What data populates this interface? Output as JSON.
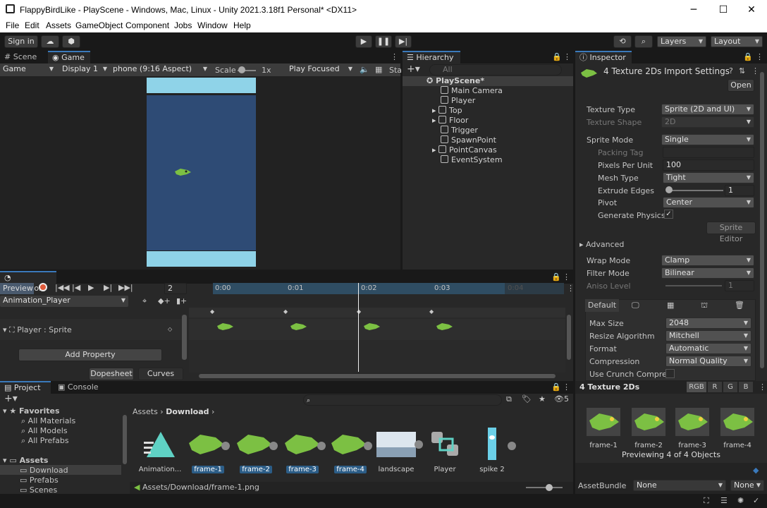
{
  "window": {
    "title": "FlappyBirdLike - PlayScene - Windows, Mac, Linux - Unity 2021.3.18f1 Personal* <DX11>"
  },
  "menu": [
    "File",
    "Edit",
    "Assets",
    "GameObject",
    "Component",
    "Jobs",
    "Window",
    "Help"
  ],
  "toolbar": {
    "sign_in": "Sign in",
    "layers": "Layers",
    "layout": "Layout"
  },
  "game": {
    "tabs": [
      "Scene",
      "Game"
    ],
    "mode": "Game",
    "display": "Display 1",
    "aspect": "phone (9:16 Aspect)",
    "scale_label": "Scale",
    "scale_value": "1x",
    "play_focused": "Play Focused",
    "stats": "Sta"
  },
  "hierarchy": {
    "tab": "Hierarchy",
    "search_placeholder": "All",
    "scene": "PlayScene*",
    "items": [
      "Main Camera",
      "Player",
      "Top",
      "Floor",
      "Trigger",
      "SpawnPoint",
      "PointCanvas",
      "EventSystem"
    ]
  },
  "inspector": {
    "tab": "Inspector",
    "title": "4 Texture 2Ds Import Settings",
    "open": "Open",
    "texture_type_label": "Texture Type",
    "texture_type": "Sprite (2D and UI)",
    "texture_shape_label": "Texture Shape",
    "texture_shape": "2D",
    "sprite_mode_label": "Sprite Mode",
    "sprite_mode": "Single",
    "packing_tag_label": "Packing Tag",
    "ppu_label": "Pixels Per Unit",
    "ppu": "100",
    "mesh_type_label": "Mesh Type",
    "mesh_type": "Tight",
    "extrude_label": "Extrude Edges",
    "extrude": "1",
    "pivot_label": "Pivot",
    "pivot": "Center",
    "gen_physics_label": "Generate Physics S",
    "sprite_editor": "Sprite Editor",
    "advanced": "Advanced",
    "wrap_label": "Wrap Mode",
    "wrap": "Clamp",
    "filter_label": "Filter Mode",
    "filter": "Bilinear",
    "aniso_label": "Aniso Level",
    "aniso": "1",
    "platform_default": "Default",
    "max_size_label": "Max Size",
    "max_size": "2048",
    "resize_label": "Resize Algorithm",
    "resize": "Mitchell",
    "format_label": "Format",
    "format": "Automatic",
    "compression_label": "Compression",
    "compression": "Normal Quality",
    "crunch_label": "Use Crunch Compres"
  },
  "preview": {
    "title": "4 Texture 2Ds",
    "channels": [
      "RGB",
      "R",
      "G",
      "B"
    ],
    "frames": [
      "frame-1",
      "frame-2",
      "frame-3",
      "frame-4"
    ],
    "status": "Previewing 4 of 4 Objects",
    "assetbundle_label": "AssetBundle",
    "assetbundle": "None",
    "variant": "None"
  },
  "animation": {
    "tab": "Animation",
    "preview": "Preview",
    "frame": "2",
    "clip": "Animation_Player",
    "property": "Player : Sprite",
    "add_property": "Add Property",
    "dopesheet": "Dopesheet",
    "curves": "Curves",
    "times": [
      "0:00",
      "0:01",
      "0:02",
      "0:03",
      "0:04"
    ]
  },
  "project": {
    "tabs": [
      "Project",
      "Console"
    ],
    "favorites": "Favorites",
    "fav_items": [
      "All Materials",
      "All Models",
      "All Prefabs"
    ],
    "assets": "Assets",
    "asset_folders": [
      "Download",
      "Prefabs",
      "Scenes"
    ],
    "breadcrumb": [
      "Assets",
      "Download"
    ],
    "files": [
      "Animation...",
      "frame-1",
      "frame-2",
      "frame-3",
      "frame-4",
      "landscape",
      "Player",
      "spike 2"
    ],
    "path": "Assets/Download/frame-1.png",
    "hidden_count": "5"
  },
  "colors": {
    "accent": "#3a79bb",
    "sky": "#8fd3e8",
    "sea": "#2e4b75",
    "bird": "#7cc043"
  }
}
